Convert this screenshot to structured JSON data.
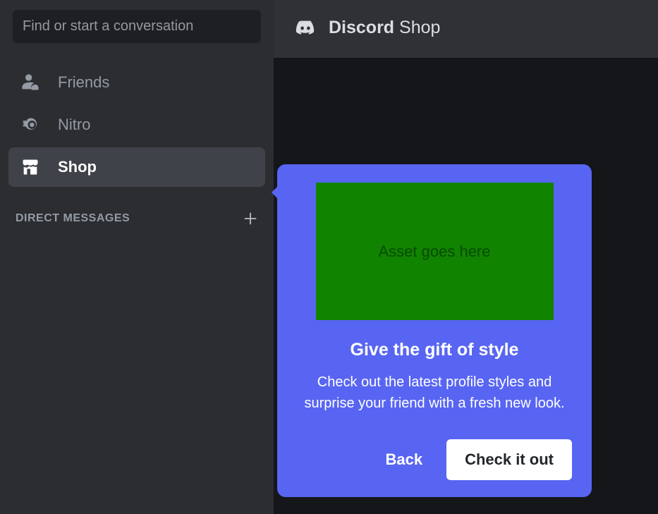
{
  "sidebar": {
    "search_placeholder": "Find or start a conversation",
    "nav": [
      {
        "label": "Friends",
        "icon": "friends-icon",
        "selected": false
      },
      {
        "label": "Nitro",
        "icon": "nitro-icon",
        "selected": false
      },
      {
        "label": "Shop",
        "icon": "shop-icon",
        "selected": true
      }
    ],
    "section": {
      "title": "DIRECT MESSAGES",
      "add_icon": "plus-icon"
    }
  },
  "header": {
    "brand": "Discord",
    "page": "Shop"
  },
  "popover": {
    "asset_label": "Asset goes here",
    "title": "Give the gift of style",
    "description": "Check out the latest profile styles and surprise your friend with a fresh new look.",
    "back_label": "Back",
    "cta_label": "Check it out"
  }
}
